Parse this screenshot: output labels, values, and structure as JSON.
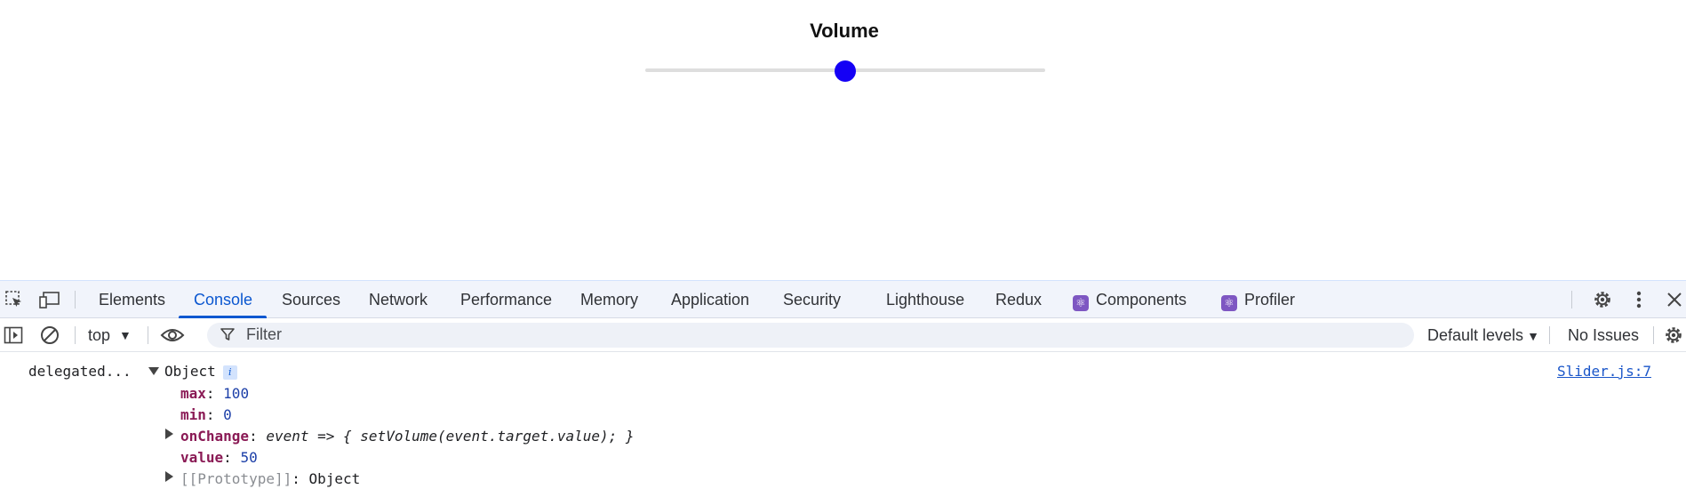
{
  "page": {
    "slider_title": "Volume",
    "slider": {
      "min": 0,
      "max": 100,
      "value": 50,
      "thumb_color": "#1400f5"
    }
  },
  "devtools": {
    "tabs": [
      {
        "label": "Elements"
      },
      {
        "label": "Console"
      },
      {
        "label": "Sources"
      },
      {
        "label": "Network"
      },
      {
        "label": "Performance"
      },
      {
        "label": "Memory"
      },
      {
        "label": "Application"
      },
      {
        "label": "Security"
      },
      {
        "label": "Lighthouse"
      },
      {
        "label": "Redux"
      },
      {
        "label": "Components",
        "icon": "react-icon"
      },
      {
        "label": "Profiler",
        "icon": "react-icon"
      }
    ],
    "active_tab": "Console",
    "toolbar": {
      "context": "top",
      "filter_placeholder": "Filter",
      "levels_label": "Default levels",
      "issues_label": "No Issues"
    },
    "console": {
      "prefix": "delegated...",
      "object_label": "Object",
      "source": "Slider.js:7",
      "props": {
        "max_key": "max",
        "max_val": "100",
        "min_key": "min",
        "min_val": "0",
        "onchange_key": "onChange",
        "onchange_val": "event => { setVolume(event.target.value); }",
        "value_key": "value",
        "value_val": "50",
        "proto_key": "[[Prototype]]",
        "proto_val": "Object"
      }
    },
    "accent_color": "#0b57d0"
  }
}
